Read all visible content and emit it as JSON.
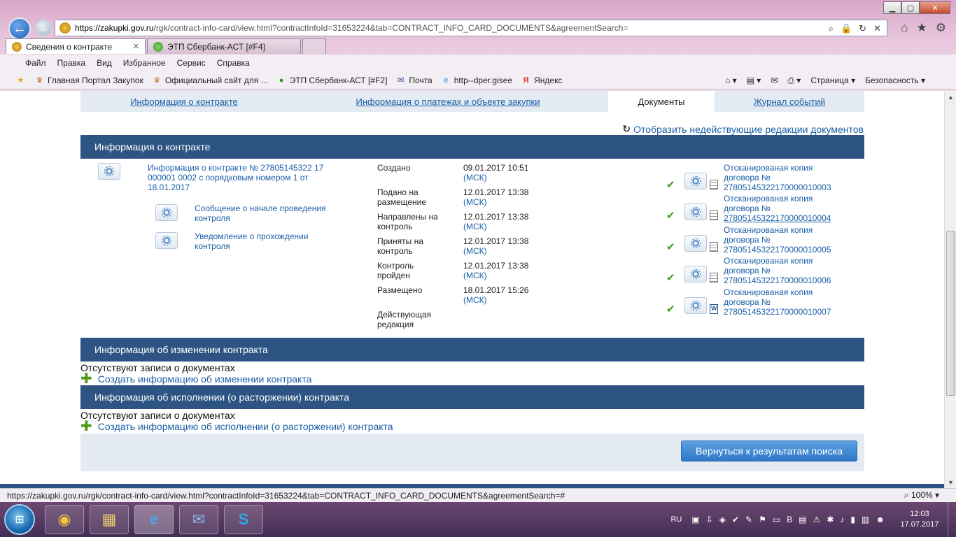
{
  "browser": {
    "url_host": "https://zakupki.gov.ru",
    "url_path": "/rgk/contract-info-card/view.html?contractInfoId=31653224&tab=CONTRACT_INFO_CARD_DOCUMENTS&agreementSearch=",
    "tabs": [
      {
        "label": "Сведения о контракте"
      },
      {
        "label": "ЭТП Сбербанк-АСТ [#F4]"
      }
    ],
    "menu": [
      "Файл",
      "Правка",
      "Вид",
      "Избранное",
      "Сервис",
      "Справка"
    ],
    "favorites": [
      {
        "label": "Главная Портал Закупок"
      },
      {
        "label": "Официальный сайт для ..."
      },
      {
        "label": "ЭТП Сбербанк-АСТ [#F2]"
      },
      {
        "label": "Почта"
      },
      {
        "label": "http--dper.gisee"
      },
      {
        "label": "Яндекс"
      }
    ],
    "tools": {
      "page": "Страница",
      "safety": "Безопасность"
    },
    "status_url": "https://zakupki.gov.ru/rgk/contract-info-card/view.html?contractInfoId=31653224&tab=CONTRACT_INFO_CARD_DOCUMENTS&agreementSearch=#",
    "zoom": "100%"
  },
  "page_tabs": [
    {
      "label": "Информация о контракте"
    },
    {
      "label": "Информация о платежах и объекте закупки"
    },
    {
      "label": "Документы"
    },
    {
      "label": "Журнал событий"
    }
  ],
  "show_inactive": "Отобразить недействующие редакции документов",
  "contract_section": {
    "title": "Информация о контракте",
    "main_doc": "Информация о контракте № 27805145322 17 000001 0002 с порядковым номером 1 от 18.01.2017",
    "sub_docs": [
      {
        "label": "Сообщение о начале проведения контроля"
      },
      {
        "label": "Уведомление о прохождении контроля"
      }
    ],
    "statuses": [
      {
        "label": "Создано",
        "date": "09.01.2017 10:51",
        "tz": "(МСК)"
      },
      {
        "label": "Подано на размещение",
        "date": "12.01.2017 13:38",
        "tz": "(МСК)"
      },
      {
        "label": "Направлены на контроль",
        "date": "12.01.2017 13:38",
        "tz": "(МСК)"
      },
      {
        "label": "Приняты на контроль",
        "date": "12.01.2017 13:38",
        "tz": "(МСК)"
      },
      {
        "label": "Контроль пройден",
        "date": "12.01.2017 13:38",
        "tz": "(МСК)"
      },
      {
        "label": "Размещено",
        "date": "18.01.2017 15:26",
        "tz": "(МСК)"
      },
      {
        "label": "Действующая редакция",
        "date": "",
        "tz": ""
      }
    ],
    "attachments": [
      {
        "line1": "Отсканированая копия",
        "line2": "договора №",
        "line3": "27805145322170000010003"
      },
      {
        "line1": "Отсканированая копия",
        "line2": "договора №",
        "line3": "27805145322170000010004"
      },
      {
        "line1": "Отсканированая копия",
        "line2": "договора №",
        "line3": "27805145322170000010005"
      },
      {
        "line1": "Отсканированая копия",
        "line2": "договора №",
        "line3": "27805145322170000010006"
      },
      {
        "line1": "Отсканированая копия",
        "line2": "договора №",
        "line3": "27805145322170000010007"
      }
    ]
  },
  "change_section": {
    "title": "Информация об изменении контракта",
    "empty_text": "Отсутствуют записи о документах",
    "create_link": "Создать информацию об изменении контракта"
  },
  "execution_section": {
    "title": "Информация об исполнении (о расторжении) контракта",
    "empty_text": "Отсутствуют записи о документах",
    "create_link": "Создать информацию об исполнении (о расторжении) контракта"
  },
  "return_button": "Вернуться к результатам поиска",
  "taskbar": {
    "lang": "RU",
    "time": "12:03",
    "date": "17.07.2017"
  }
}
